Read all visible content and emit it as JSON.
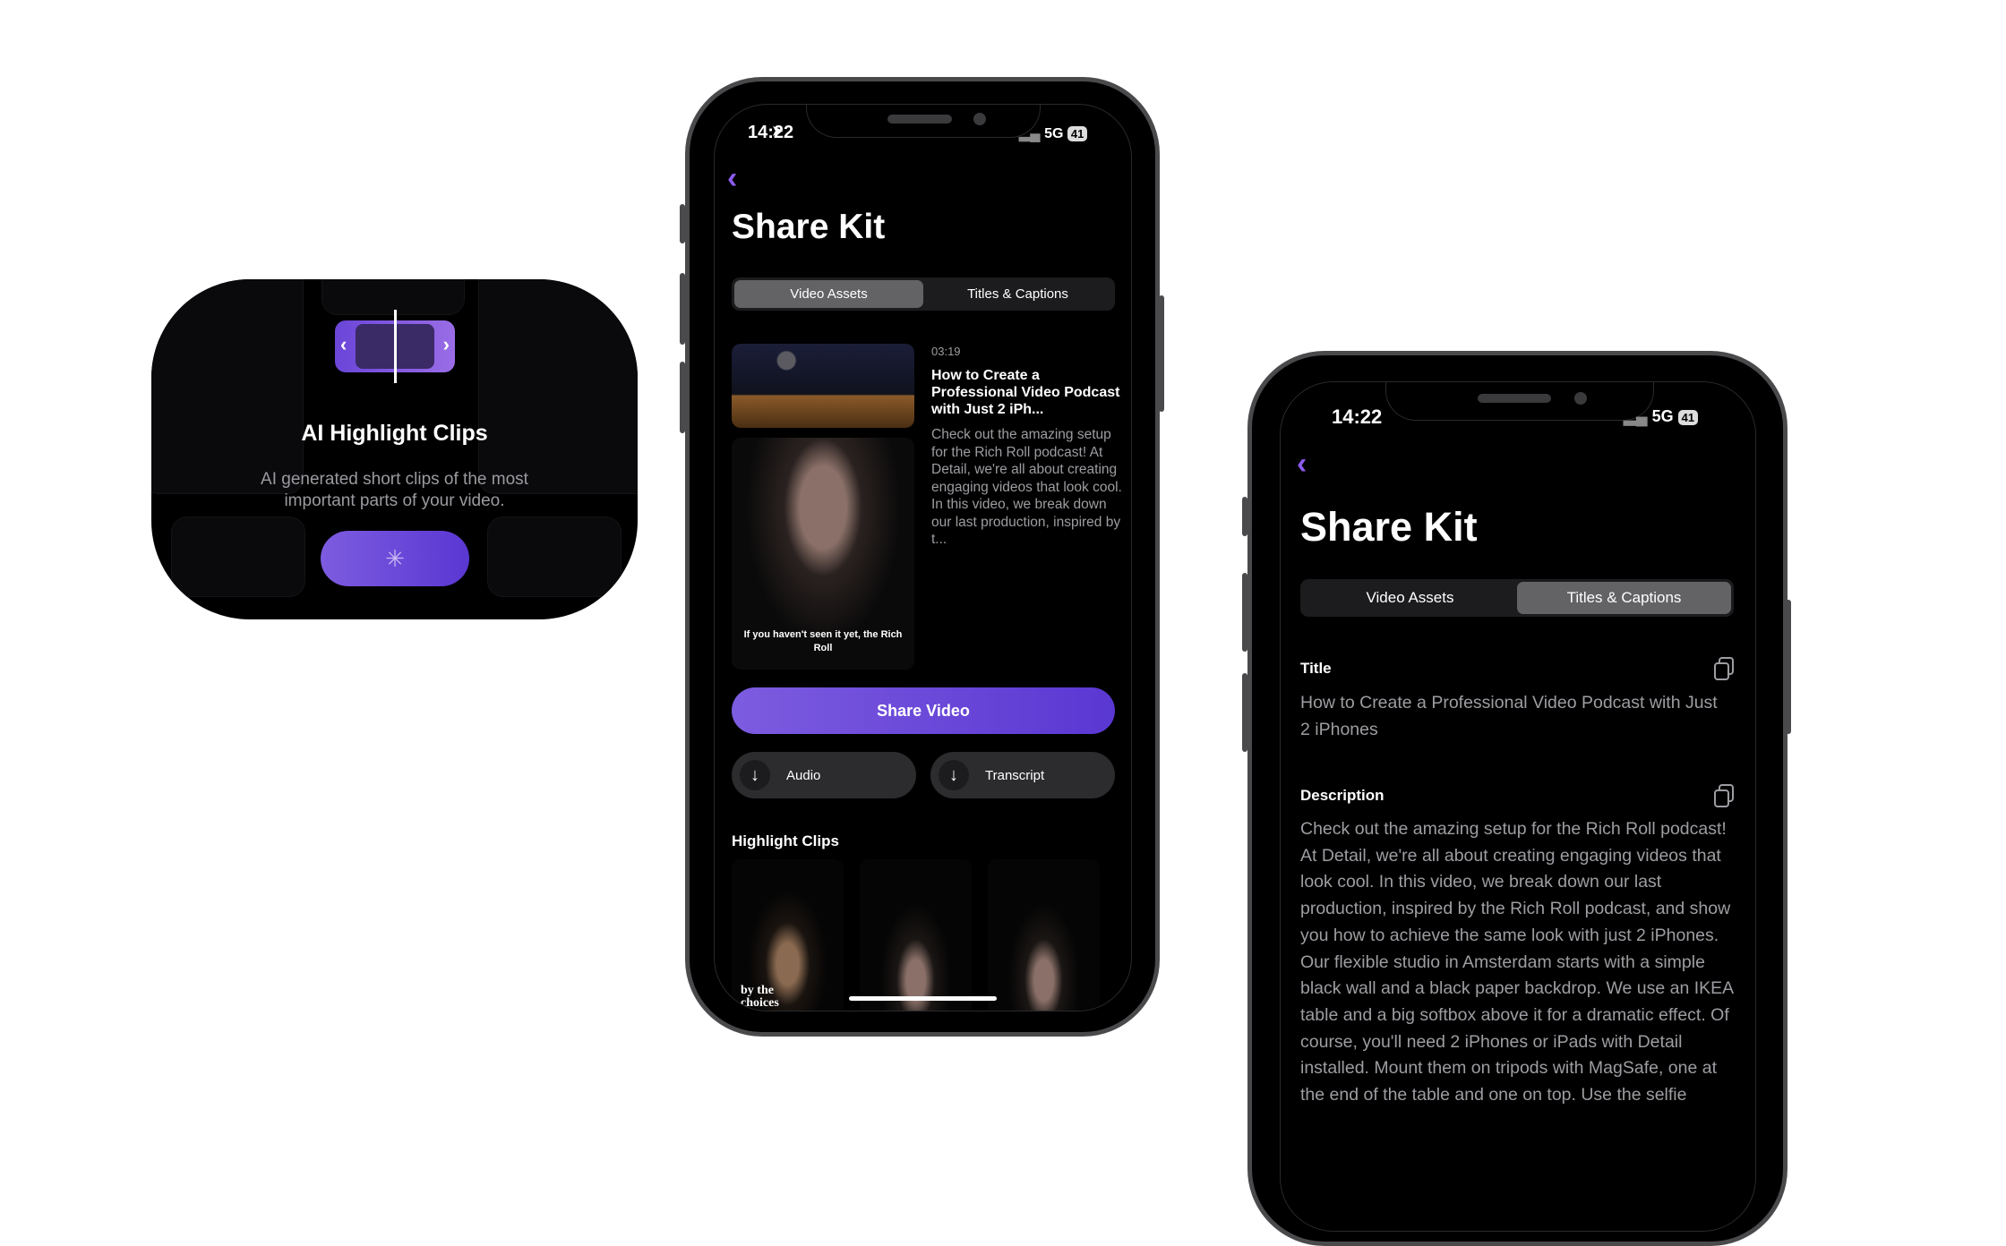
{
  "feature_card": {
    "title": "AI Highlight Clips",
    "subtitle": "AI generated short clips of the most important parts of your video.",
    "button_state": "loading",
    "accent": "#6a45d8"
  },
  "phone_video_assets": {
    "status": {
      "time": "14:22",
      "network": "5G",
      "battery": "41"
    },
    "title": "Share Kit",
    "tabs": [
      {
        "label": "Video Assets",
        "selected": true
      },
      {
        "label": "Titles & Captions",
        "selected": false
      }
    ],
    "video": {
      "duration": "03:19",
      "title": "How to Create a Professional Video Podcast with Just 2 iPh...",
      "description": "Check out the amazing setup for the Rich Roll podcast! At Detail, we're all about creating engaging videos that look cool. In this video, we break down our last production, inspired by t...",
      "caption_overlay": "If you haven't seen it yet, the Rich Roll"
    },
    "share_button": "Share Video",
    "downloads": [
      {
        "label": "Audio",
        "icon": "arrow-down-icon"
      },
      {
        "label": "Transcript",
        "icon": "arrow-down-icon"
      }
    ],
    "highlight_clips": {
      "label": "Highlight Clips",
      "clip_captions": [
        "by the choices",
        "",
        ""
      ]
    },
    "accent": "#6f4ee0"
  },
  "phone_titles": {
    "status": {
      "time": "14:22",
      "network": "5G",
      "battery": "41"
    },
    "title": "Share Kit",
    "tabs": [
      {
        "label": "Video Assets",
        "selected": false
      },
      {
        "label": "Titles & Captions",
        "selected": true
      }
    ],
    "title_section": {
      "label": "Title",
      "value": "How to Create a Professional Video Podcast with Just 2 iPhones"
    },
    "description_section": {
      "label": "Description",
      "value": "Check out the amazing setup for the Rich Roll podcast! At Detail, we're all about creating engaging videos that look cool. In this video, we break down our last production, inspired by the Rich Roll podcast, and show you how to achieve the same look with just 2 iPhones. Our flexible studio in Amsterdam starts with a simple black wall and a black paper backdrop. We use an IKEA table and a big softbox above it for a dramatic effect. Of course, you'll need 2 iPhones or iPads with Detail installed. Mount them on tripods with MagSafe, one at the end of the table and one on top. Use the selfie"
    }
  }
}
